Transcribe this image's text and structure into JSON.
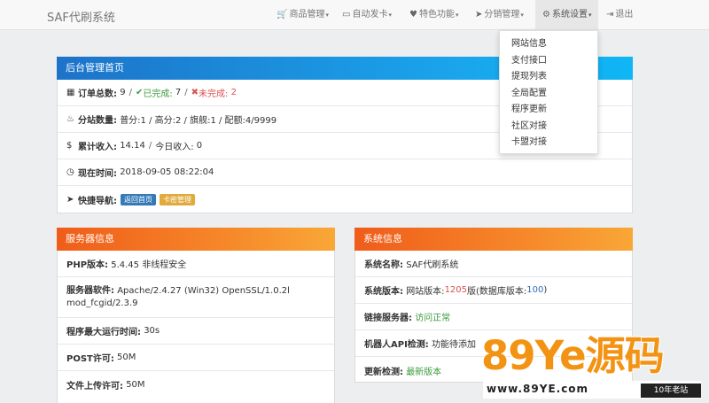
{
  "navbar": {
    "brand": "SAF代刷系统",
    "items": [
      {
        "icon": "🛒",
        "label": "商品管理",
        "caret": "▾"
      },
      {
        "icon": "▭",
        "label": "自动发卡",
        "caret": "▾"
      },
      {
        "icon": "♥",
        "label": "特色功能",
        "caret": "▾"
      },
      {
        "icon": "➤",
        "label": "分销管理",
        "caret": "▾"
      },
      {
        "icon": "⚙",
        "label": "系统设置",
        "caret": "▾"
      },
      {
        "icon": "⇥",
        "label": "退出",
        "caret": ""
      }
    ]
  },
  "dropdown": {
    "items": [
      "网站信息",
      "支付接口",
      "提现列表",
      "全局配置",
      "程序更新",
      "社区对接",
      "卡盟对接"
    ]
  },
  "admin": {
    "title": "后台管理首页",
    "orders": {
      "label": "订单总数:",
      "total": "9",
      "done_label": "已完成:",
      "done": "7",
      "undone_label": "未完成:",
      "undone": "2",
      "sep": "/"
    },
    "branches": {
      "label": "分站数量:",
      "value": "普分:1 / 高分:2 / 旗舰:1 / 配额:4/9999"
    },
    "income": {
      "label": "累计收入:",
      "total": "14.14",
      "today_label": "今日收入:",
      "today": "0",
      "sep": "/"
    },
    "time": {
      "label": "现在时间:",
      "value": "2018-09-05 08:22:04"
    },
    "nav": {
      "label": "快捷导航:",
      "btn1": "返回首页",
      "btn2": "卡密管理"
    }
  },
  "server": {
    "title": "服务器信息",
    "php": {
      "label": "PHP版本:",
      "value": "5.4.45 非线程安全"
    },
    "software": {
      "label": "服务器软件:",
      "value1": "Apache/2.4.27 (Win32) OpenSSL/1.0.2l",
      "value2": "mod_fcgid/2.3.9"
    },
    "max_time": {
      "label": "程序最大运行时间:",
      "value": "30s"
    },
    "post": {
      "label": "POST许可:",
      "value": "50M"
    },
    "upload": {
      "label": "文件上传许可:",
      "value": "50M"
    }
  },
  "system": {
    "title": "系统信息",
    "name": {
      "label": "系统名称:",
      "value": "SAF代刷系统"
    },
    "version": {
      "label": "系统版本:",
      "prefix": "网站版本:",
      "site_ver": "1205",
      "mid": "版(数据库版本:",
      "db_ver": "100",
      "suffix": ")"
    },
    "link": {
      "label": "链接服务器:",
      "value": "访问正常"
    },
    "robot": {
      "label": "机器人API检测:",
      "value": "功能待添加"
    },
    "update": {
      "label": "更新检测:",
      "value": "最新版本"
    }
  },
  "watermark": {
    "big": "89Ye源码",
    "url": "www.89YE.com",
    "tag": "10年老站"
  },
  "colors": {
    "blue_head": "#1aa5ec",
    "orange_head": "#f6872a",
    "green": "#3c9b3c",
    "red": "#d9534f"
  }
}
